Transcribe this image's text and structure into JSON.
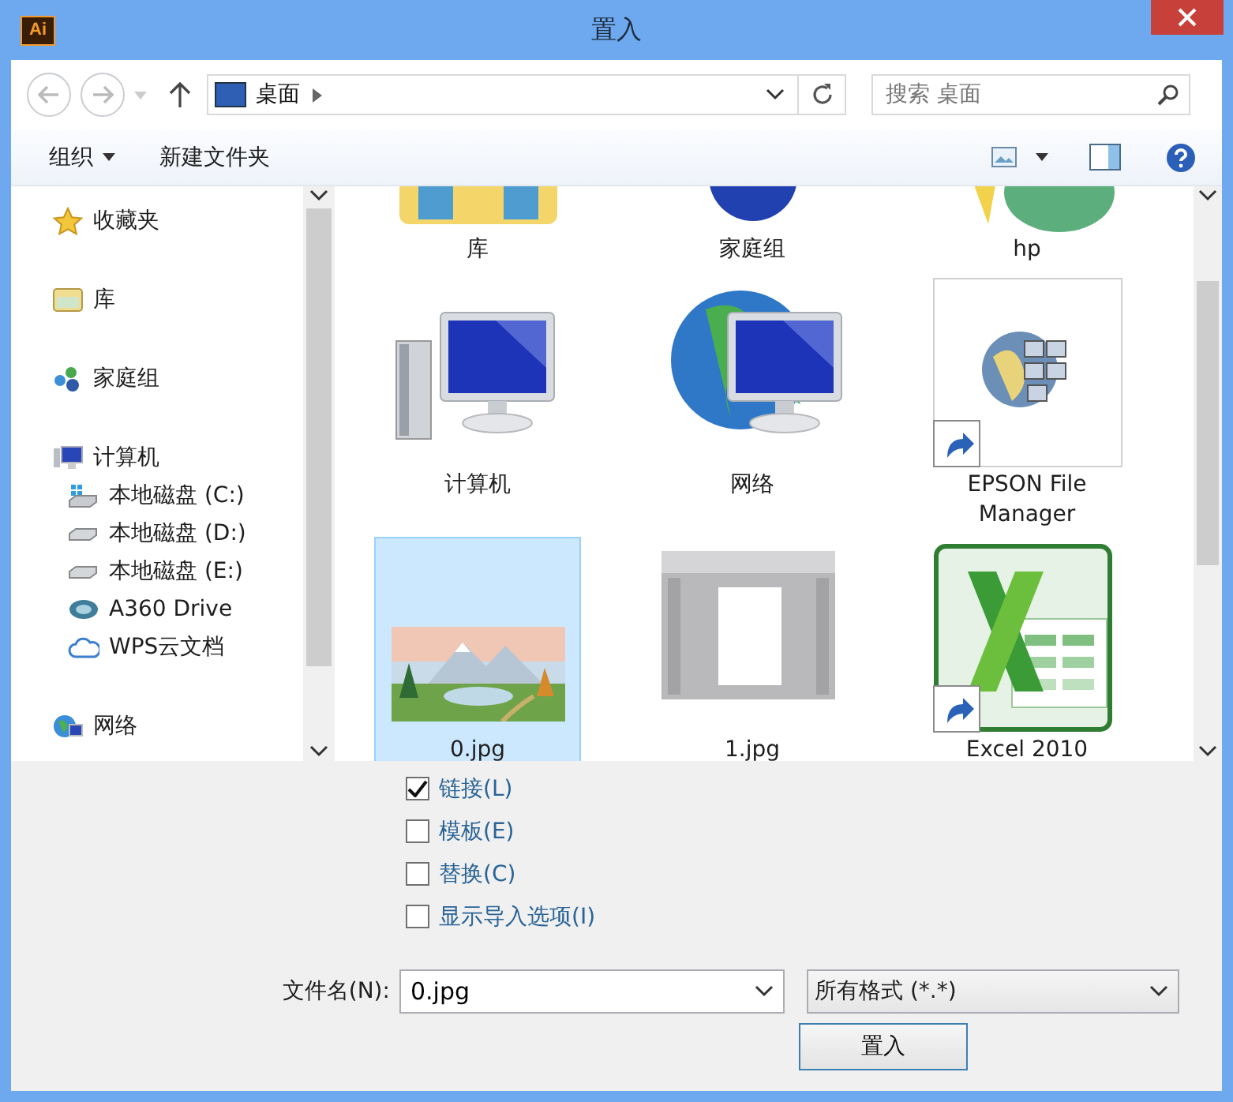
{
  "window": {
    "app_badge": "Ai",
    "title": "置入"
  },
  "nav": {
    "address": "桌面",
    "search": {
      "placeholder": "搜索 桌面"
    }
  },
  "toolbar": {
    "organize": "组织",
    "new_folder": "新建文件夹"
  },
  "sidebar": {
    "items": [
      {
        "label": "收藏夹",
        "kind": "star"
      },
      {
        "label": "库",
        "kind": "library"
      },
      {
        "label": "家庭组",
        "kind": "homegroup"
      },
      {
        "label": "计算机",
        "kind": "computer",
        "children": [
          {
            "label": "本地磁盘 (C:)",
            "kind": "system-drive"
          },
          {
            "label": "本地磁盘 (D:)",
            "kind": "drive"
          },
          {
            "label": "本地磁盘 (E:)",
            "kind": "drive"
          },
          {
            "label": "A360 Drive",
            "kind": "a360"
          },
          {
            "label": "WPS云文档",
            "kind": "cloud"
          }
        ]
      },
      {
        "label": "网络",
        "kind": "network"
      }
    ]
  },
  "files": [
    {
      "label": "库",
      "kind": "library",
      "selected": false,
      "shortcut": false
    },
    {
      "label": "家庭组",
      "kind": "homegroup",
      "selected": false,
      "shortcut": false
    },
    {
      "label": "hp",
      "kind": "user",
      "selected": false,
      "shortcut": false
    },
    {
      "label": "计算机",
      "kind": "computer",
      "selected": false,
      "shortcut": false
    },
    {
      "label": "网络",
      "kind": "network",
      "selected": false,
      "shortcut": false
    },
    {
      "label": "EPSON File Manager",
      "kind": "epson",
      "selected": false,
      "shortcut": true
    },
    {
      "label": "0.jpg",
      "selected": true,
      "shortcut": false
    },
    {
      "label": "1.jpg",
      "kind": "screenshot",
      "selected": false,
      "shortcut": false
    },
    {
      "label": "Excel 2010",
      "kind": "excel",
      "selected": false,
      "shortcut": true
    }
  ],
  "options": [
    {
      "label": "链接(L)",
      "checked": true
    },
    {
      "label": "模板(E)",
      "checked": false
    },
    {
      "label": "替换(C)",
      "checked": false
    },
    {
      "label": "显示导入选项(I)",
      "checked": false
    }
  ],
  "filename": {
    "label": "文件名(N):",
    "value": "0.jpg"
  },
  "filetype": {
    "value": "所有格式 (*.*)"
  },
  "place_button": "置入"
}
